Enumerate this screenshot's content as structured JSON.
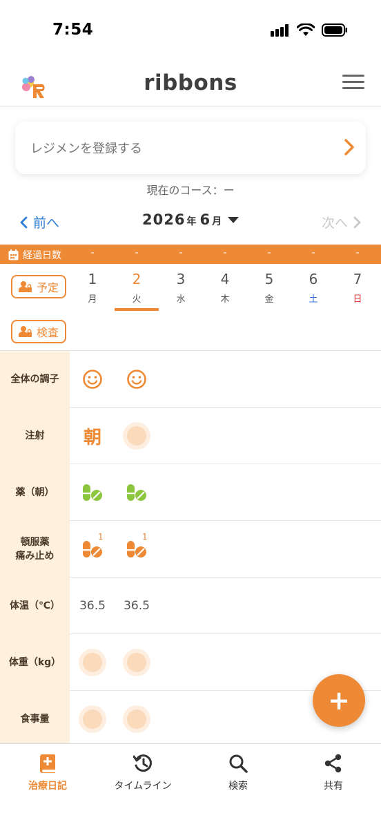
{
  "status_bar": {
    "time": "7:54"
  },
  "header": {
    "title": "ribbons"
  },
  "regimen": {
    "label": "レジメンを登録する",
    "course": "現在のコース：ー"
  },
  "month_nav": {
    "prev_label": "前へ",
    "next_label": "次へ",
    "year": "2026",
    "year_unit": "年",
    "month": "6",
    "month_unit": "月"
  },
  "elapsed": {
    "label": "経過日数",
    "values": [
      "-",
      "-",
      "-",
      "-",
      "-",
      "-",
      "-"
    ]
  },
  "schedule": {
    "plan_label": "予定",
    "exam_label": "検査",
    "days": [
      {
        "num": "1",
        "weekday": "月"
      },
      {
        "num": "2",
        "weekday": "火"
      },
      {
        "num": "3",
        "weekday": "水"
      },
      {
        "num": "4",
        "weekday": "木"
      },
      {
        "num": "5",
        "weekday": "金"
      },
      {
        "num": "6",
        "weekday": "土"
      },
      {
        "num": "7",
        "weekday": "日"
      }
    ],
    "selected_day": "2"
  },
  "rows": {
    "condition": {
      "label": "全体の調子",
      "day1": "smiley-icon",
      "day2": "smiley-icon"
    },
    "injection": {
      "label": "注射",
      "day1": "朝"
    },
    "medicine": {
      "label": "薬（朝）",
      "day1": "pill-icon",
      "day2": "pill-icon"
    },
    "prn": {
      "line1": "頓服薬",
      "line2": "痛み止め",
      "day1_count": "1",
      "day2_count": "1"
    },
    "temperature": {
      "label": "体温（℃）",
      "day1": "36.5",
      "day2": "36.5"
    },
    "weight": {
      "label": "体重（kg）"
    },
    "meal": {
      "label": "食事量"
    }
  },
  "fab": {
    "label": "+"
  },
  "bottom_nav": [
    {
      "label": "治療日記",
      "icon": "diary-icon",
      "active": true
    },
    {
      "label": "タイムライン",
      "icon": "history-icon",
      "active": false
    },
    {
      "label": "検索",
      "icon": "search-icon",
      "active": false
    },
    {
      "label": "共有",
      "icon": "share-icon",
      "active": false
    }
  ],
  "colors": {
    "accent": "#ee8a35",
    "link": "#2f7fd6",
    "saturday": "#2f6fd6",
    "sunday": "#e03b3b",
    "medicine_green": "#8cc63f",
    "label_bg": "#fdf0dc"
  }
}
